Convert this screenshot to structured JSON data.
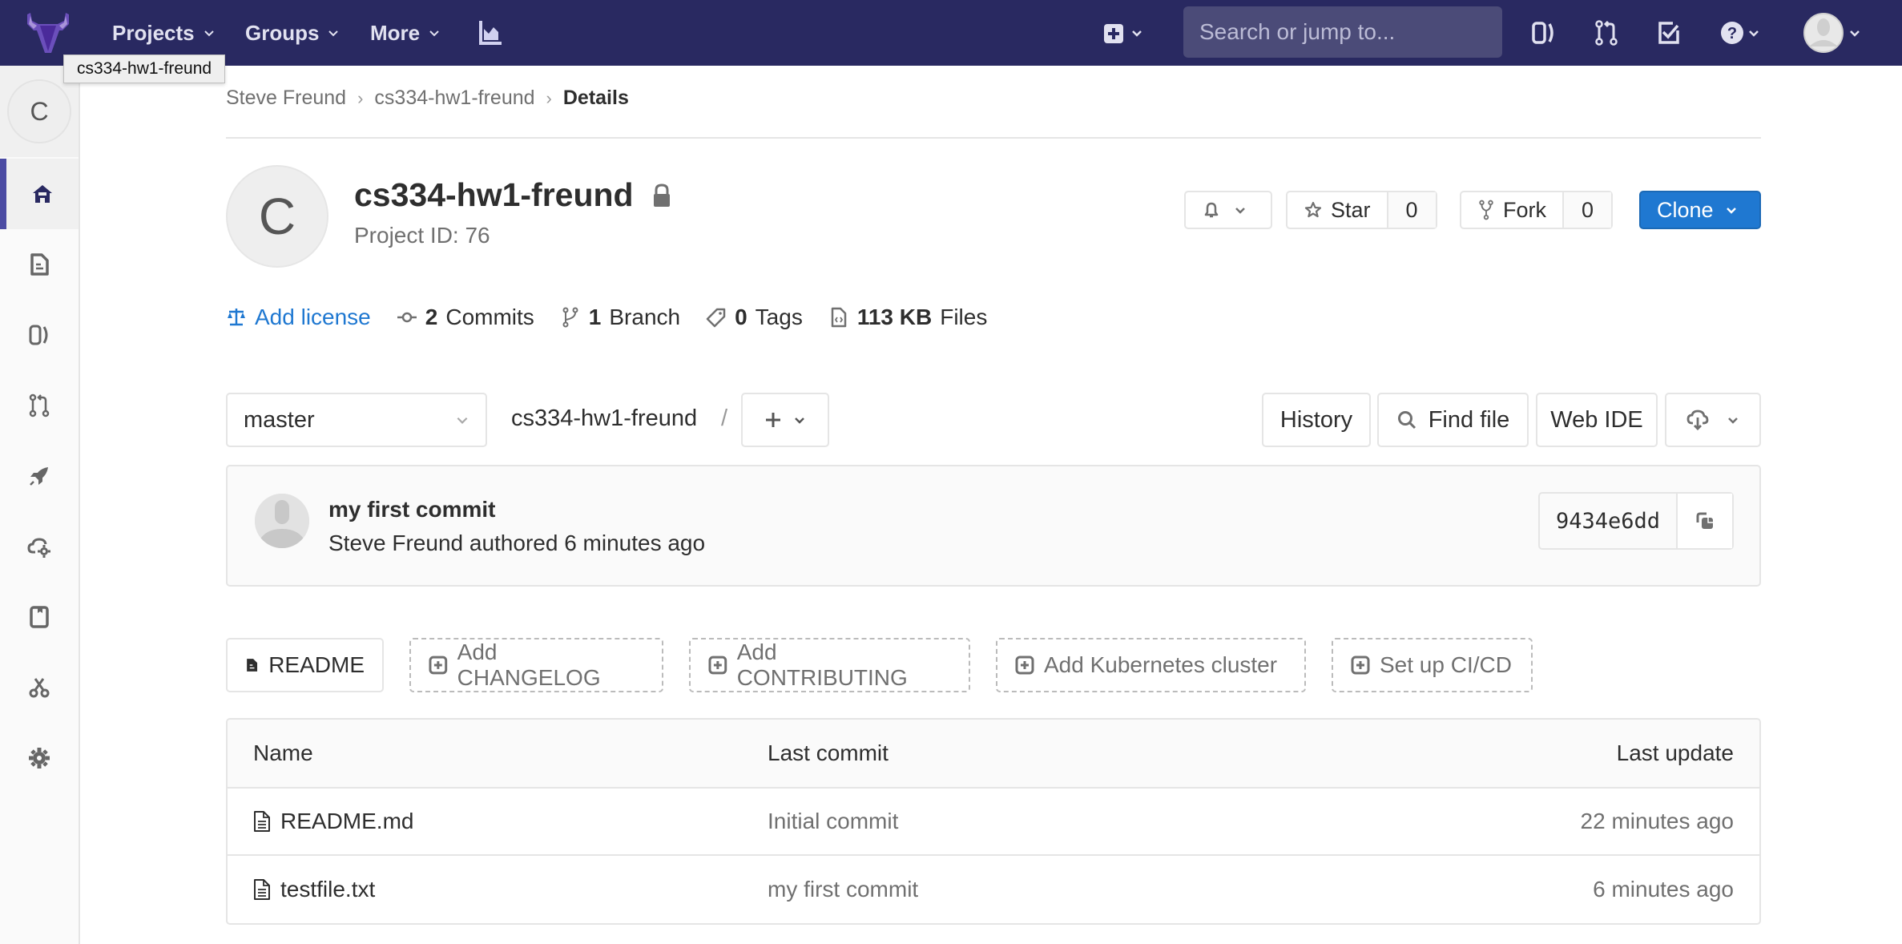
{
  "topnav": {
    "logo": "gitlab-logo",
    "items": [
      {
        "label": "Projects",
        "icon": "chevron-down-icon"
      },
      {
        "label": "Groups",
        "icon": "chevron-down-icon"
      },
      {
        "label": "More",
        "icon": "chevron-down-icon"
      }
    ],
    "activity_icon": "chart-icon",
    "new_icon": "plus-square-icon",
    "search_placeholder": "Search or jump to...",
    "right_icons": [
      "issues-icon",
      "merge-request-icon",
      "todo-icon",
      "help-icon"
    ],
    "avatar": "user-avatar"
  },
  "tooltip": "cs334-hw1-freund",
  "sidebar": {
    "project_letter": "C",
    "items": [
      {
        "name": "project-overview",
        "icon": "home-icon",
        "active": true
      },
      {
        "name": "repository",
        "icon": "file-icon"
      },
      {
        "name": "issues",
        "icon": "issues-icon"
      },
      {
        "name": "merge-requests",
        "icon": "merge-request-icon"
      },
      {
        "name": "ci-cd",
        "icon": "rocket-icon"
      },
      {
        "name": "operations",
        "icon": "cloud-gear-icon"
      },
      {
        "name": "wiki",
        "icon": "book-icon"
      },
      {
        "name": "snippets",
        "icon": "scissors-icon"
      },
      {
        "name": "settings",
        "icon": "gear-icon"
      }
    ]
  },
  "breadcrumb": [
    {
      "label": "Steve Freund"
    },
    {
      "label": "cs334-hw1-freund"
    },
    {
      "label": "Details"
    }
  ],
  "project": {
    "avatar_letter": "C",
    "name": "cs334-hw1-freund",
    "visibility_icon": "lock-icon",
    "id_label": "Project ID: 76",
    "star_label": "Star",
    "star_count": "0",
    "fork_label": "Fork",
    "fork_count": "0",
    "clone_label": "Clone"
  },
  "stats": {
    "license": "Add license",
    "commits_count": "2",
    "commits_label": "Commits",
    "branch_count": "1",
    "branch_label": "Branch",
    "tags_count": "0",
    "tags_label": "Tags",
    "files_size": "113 KB",
    "files_label": "Files"
  },
  "repo_toolbar": {
    "branch": "master",
    "path": "cs334-hw1-freund",
    "path_sep": "/",
    "history": "History",
    "find_file": "Find file",
    "web_ide": "Web IDE"
  },
  "last_commit": {
    "title": "my first commit",
    "author_line": "Steve Freund authored 6 minutes ago",
    "sha": "9434e6dd"
  },
  "quick_actions": [
    {
      "label": "README",
      "style": "solid"
    },
    {
      "label": "Add CHANGELOG",
      "style": "dashed"
    },
    {
      "label": "Add CONTRIBUTING",
      "style": "dashed"
    },
    {
      "label": "Add Kubernetes cluster",
      "style": "dashed"
    },
    {
      "label": "Set up CI/CD",
      "style": "dashed"
    }
  ],
  "file_tree": {
    "columns": [
      "Name",
      "Last commit",
      "Last update"
    ],
    "rows": [
      {
        "name": "README.md",
        "last_commit": "Initial commit",
        "last_update": "22 minutes ago"
      },
      {
        "name": "testfile.txt",
        "last_commit": "my first commit",
        "last_update": "6 minutes ago"
      }
    ]
  },
  "colors": {
    "nav_bg": "#292961",
    "accent": "#1f78d1",
    "sidebar_active": "#4b4ba3"
  }
}
